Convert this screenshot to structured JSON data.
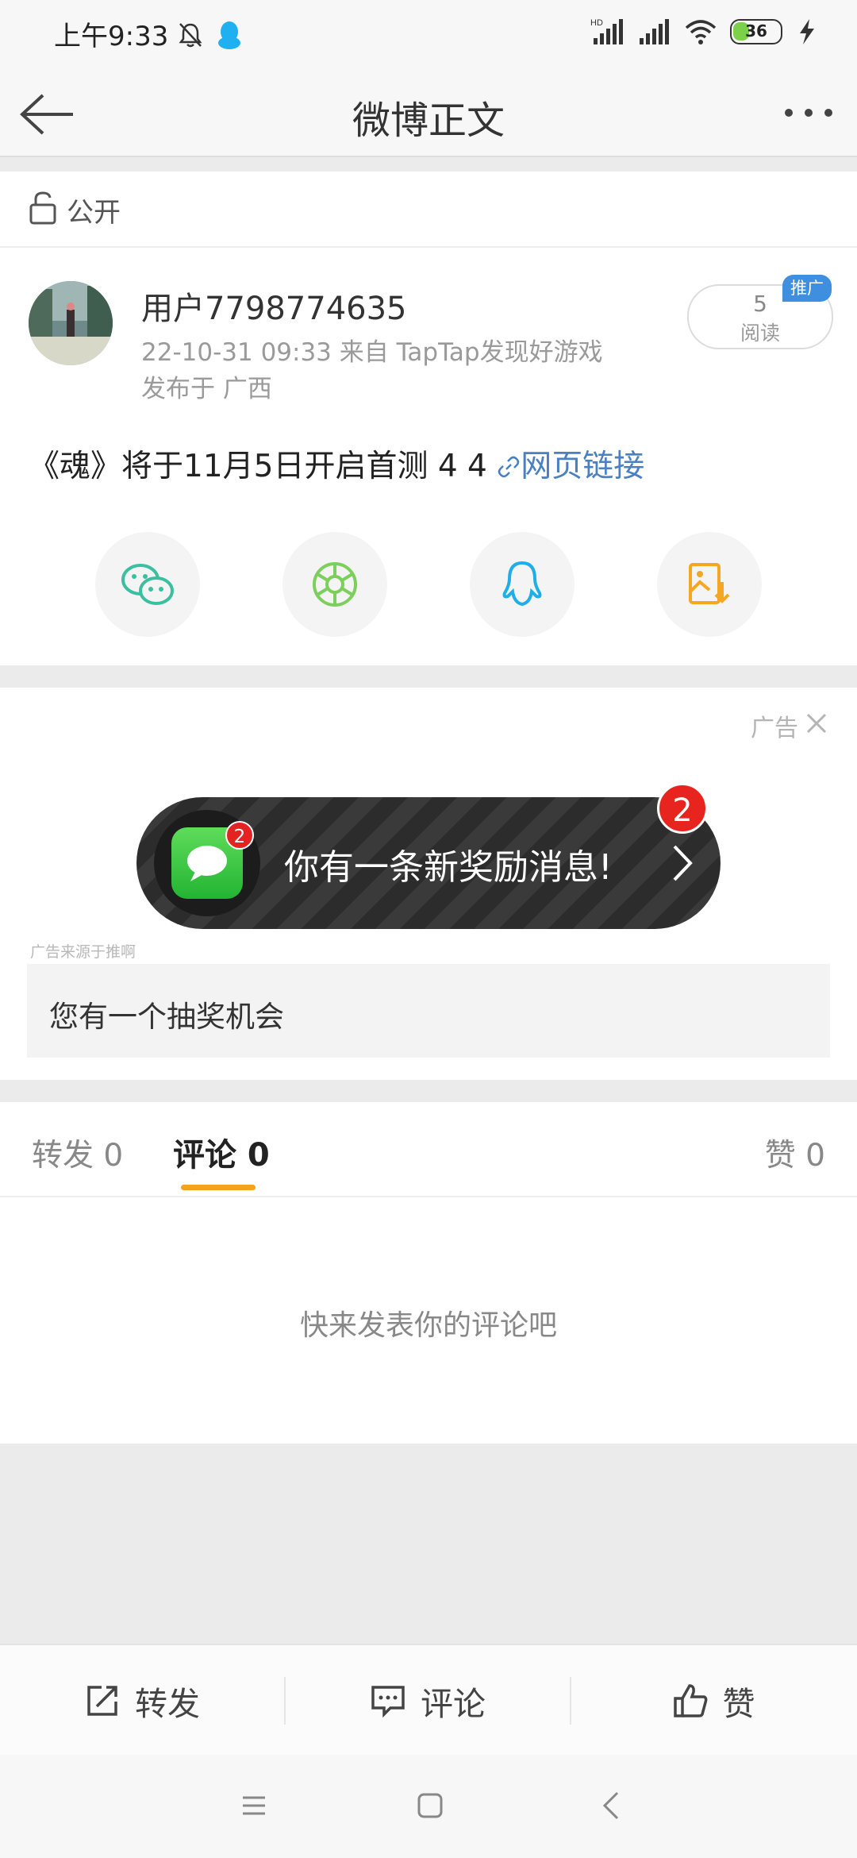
{
  "status_bar": {
    "time": "上午9:33",
    "battery": "36",
    "network": "HD"
  },
  "nav": {
    "title": "微博正文"
  },
  "visibility": {
    "label": "公开"
  },
  "post": {
    "username": "用户7798774635",
    "meta": "22-10-31 09:33  来自 TapTap发现好游戏",
    "location": "发布于 广西",
    "read_count": "5",
    "read_label": "阅读",
    "promo_badge": "推广",
    "text": "《魂》将于11月5日开启首测 4 4 ",
    "link_text": "网页链接"
  },
  "ad": {
    "label": "广告",
    "banner_text": "你有一条新奖励消息!",
    "app_badge": "2",
    "count_badge": "2",
    "source": "广告来源于推啊",
    "box_text": "您有一个抽奖机会"
  },
  "tabs": {
    "repost": "转发 0",
    "comment": "评论 0",
    "like": "赞 0"
  },
  "comments": {
    "empty_hint": "快来发表你的评论吧"
  },
  "actions": {
    "repost": "转发",
    "comment": "评论",
    "like": "赞"
  },
  "colors": {
    "accent": "#f7a21b",
    "link": "#4a7fc1",
    "promo": "#3f8fe0",
    "badge_red": "#e8241f"
  }
}
